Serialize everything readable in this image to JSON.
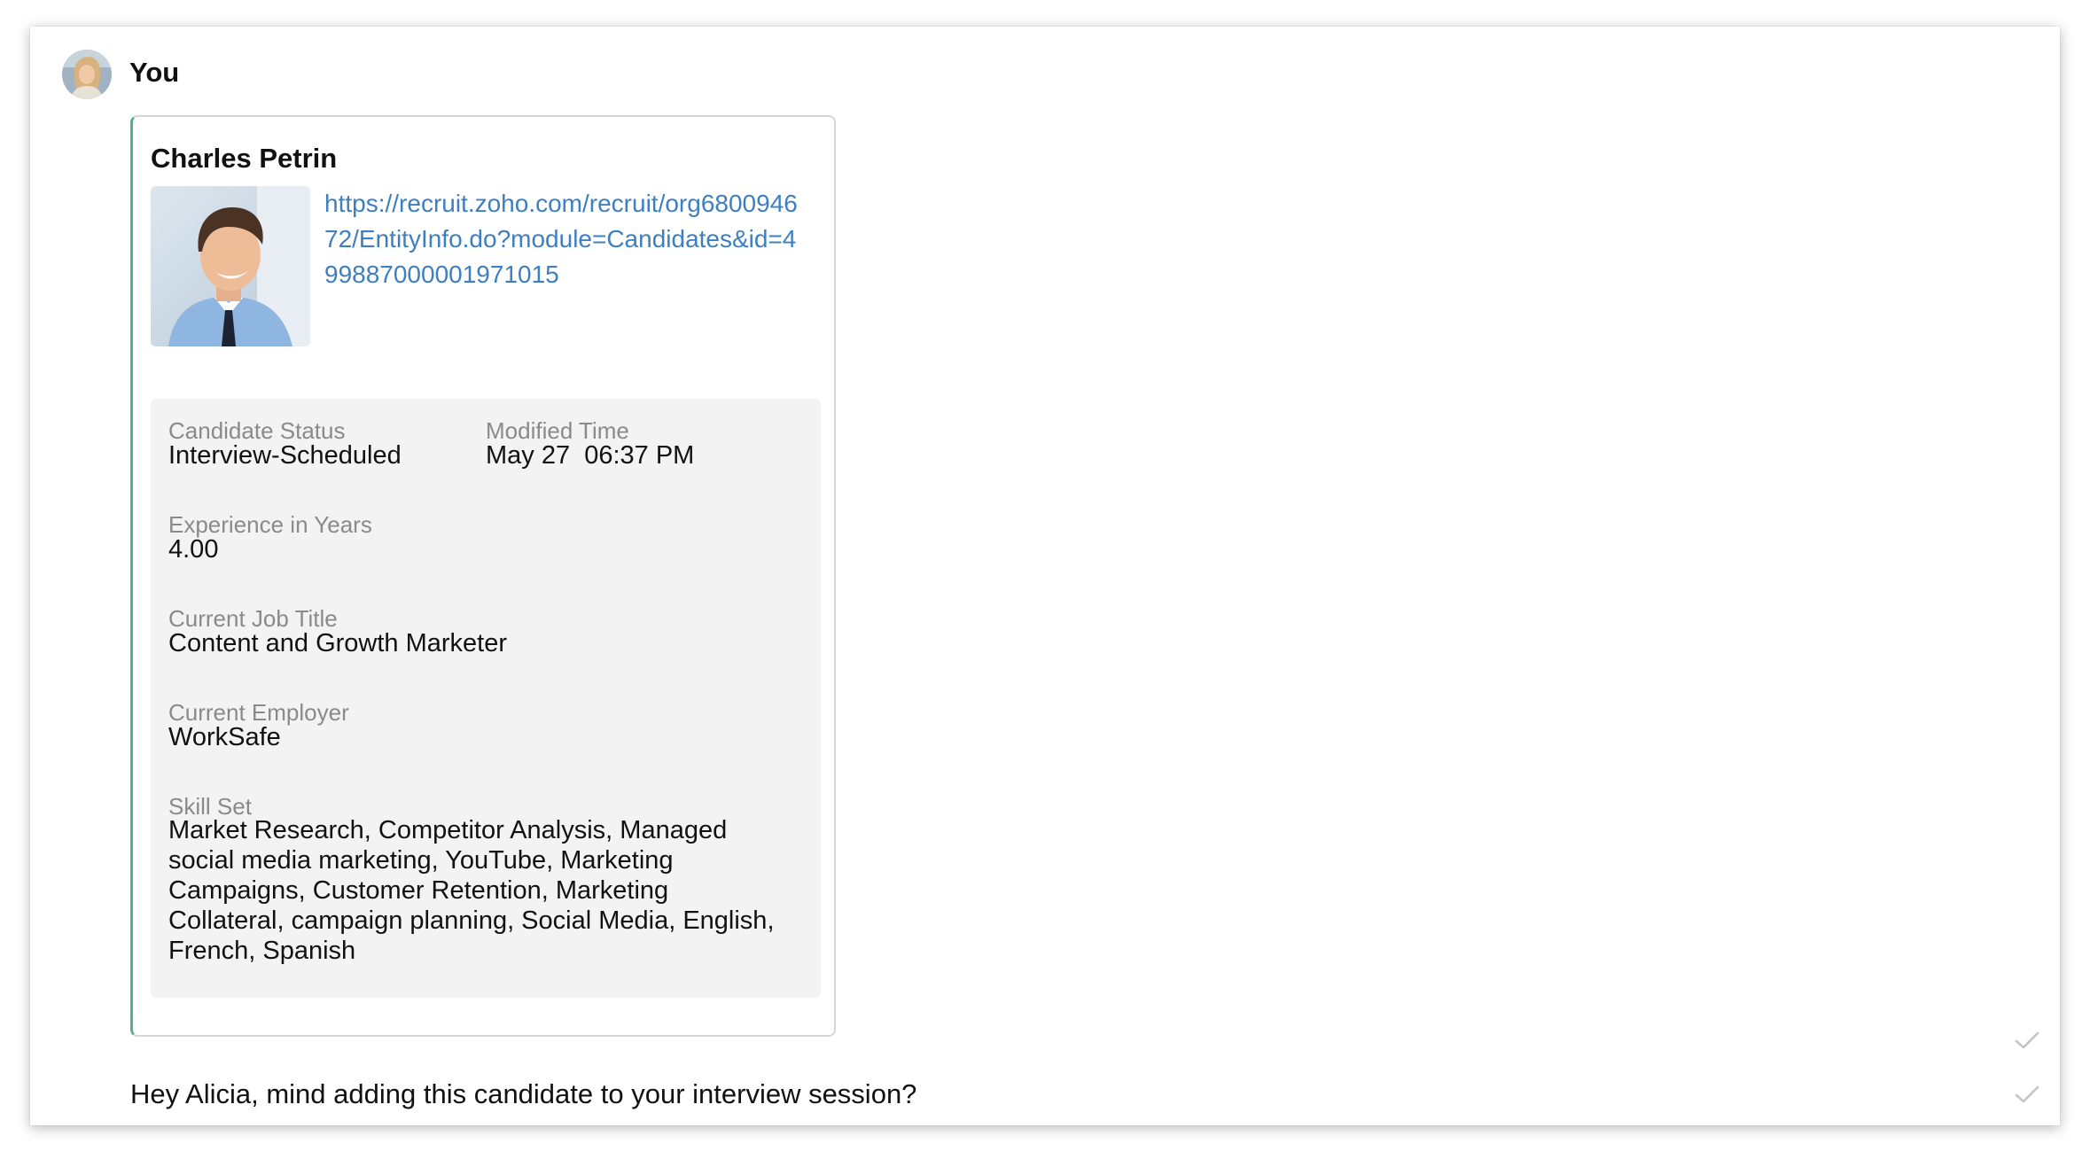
{
  "sender": {
    "name": "You",
    "avatar_icon": "user-avatar-photo"
  },
  "card": {
    "accent_color": "#4fb387",
    "candidate_name": "Charles Petrin",
    "photo_icon": "candidate-photo",
    "link": "https://recruit.zoho.com/recruit/org680094672/EntityInfo.do?module=Candidates&id=499887000001971015",
    "fields": {
      "candidate_status": {
        "label": "Candidate Status",
        "value": "Interview-Scheduled"
      },
      "modified_time": {
        "label": "Modified Time",
        "value": "May 27  06:37 PM"
      },
      "experience": {
        "label": "Experience in Years",
        "value": "4.00"
      },
      "job_title": {
        "label": "Current Job Title",
        "value": "Content and Growth Marketer"
      },
      "employer": {
        "label": "Current Employer",
        "value": "WorkSafe"
      },
      "skill_set": {
        "label": "Skill Set",
        "value": "Market Research, Competitor Analysis, Managed social media marketing, YouTube, Marketing Campaigns, Customer Retention, Marketing Collateral, campaign planning, Social Media, English, French, Spanish"
      }
    }
  },
  "message": {
    "text": "Hey Alicia, mind adding this candidate to your interview session?"
  },
  "status_icons": [
    "checkmark-icon",
    "checkmark-icon"
  ]
}
